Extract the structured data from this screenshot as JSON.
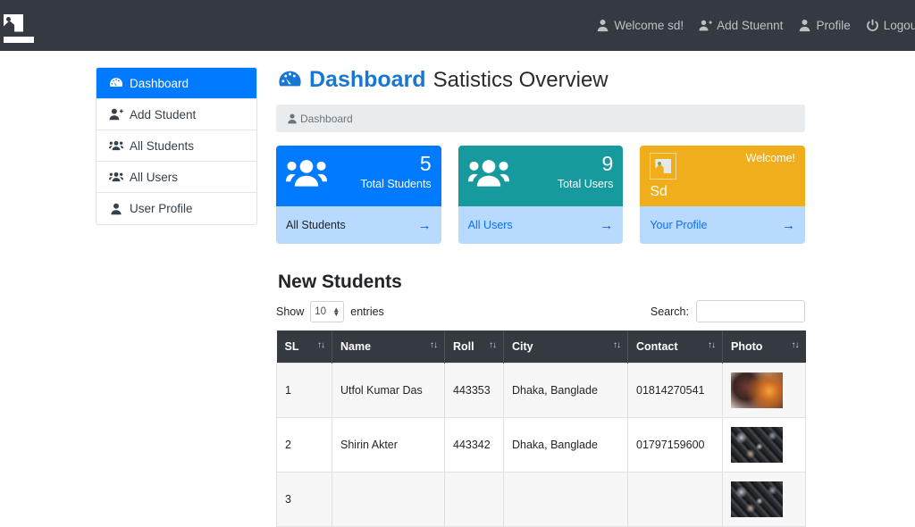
{
  "navbar": {
    "brand_icon": "broken-image-icon",
    "links": [
      {
        "label": "Welcome sd!",
        "icon": "user-icon"
      },
      {
        "label": "Add Stuennt",
        "icon": "user-plus-icon"
      },
      {
        "label": "Profile",
        "icon": "user-icon"
      },
      {
        "label": "Logout",
        "icon": "power-off-icon"
      }
    ]
  },
  "sidebar": {
    "items": [
      {
        "label": "Dashboard",
        "icon": "tachometer-icon",
        "active": true
      },
      {
        "label": "Add Student",
        "icon": "user-plus-icon",
        "active": false
      },
      {
        "label": "All Students",
        "icon": "users-icon",
        "active": false
      },
      {
        "label": "All Users",
        "icon": "users-icon",
        "active": false
      },
      {
        "label": "User Profile",
        "icon": "user-icon",
        "active": false
      }
    ]
  },
  "header": {
    "icon": "tachometer-icon",
    "title": "Dashboard",
    "subtitle": "Satistics Overview",
    "breadcrumb": "Dashboard",
    "breadcrumb_icon": "user-icon"
  },
  "cards": [
    {
      "value": "5",
      "label": "Total Students",
      "footer": "All Students",
      "color": "#007bff",
      "footer_color": "#b8daff",
      "icon": "users-icon",
      "arrow": "→"
    },
    {
      "value": "9",
      "label": "Total Users",
      "footer": "All Users",
      "color": "#179a9e",
      "footer_color": "#b8daff",
      "icon": "users-icon",
      "arrow": "→"
    },
    {
      "value": "Welcome!",
      "label": "Sd",
      "footer": "Your Profile",
      "color": "#f0ad1c",
      "footer_color": "#b8daff",
      "icon": "broken-image-icon",
      "arrow": "→"
    }
  ],
  "table_section": {
    "title": "New Students",
    "show_label": "Show",
    "entries_label": "entries",
    "page_size": "10",
    "search_label": "Search:",
    "search_value": "",
    "search_placeholder": "",
    "sort_icon": "↑↓",
    "columns": [
      "SL",
      "Name",
      "Roll",
      "City",
      "Contact",
      "Photo"
    ],
    "rows": [
      {
        "sl": "1",
        "name": "Utfol Kumar Das",
        "roll": "443353",
        "city": "Dhaka, Banglade",
        "contact": "01814270541",
        "photo": "student-photo-1"
      },
      {
        "sl": "2",
        "name": "Shirin Akter",
        "roll": "443342",
        "city": "Dhaka, Banglade",
        "contact": "01797159600",
        "photo": "student-photo-2"
      },
      {
        "sl": "3",
        "name": "",
        "roll": "",
        "city": "",
        "contact": "",
        "photo": "student-photo-3"
      }
    ]
  }
}
